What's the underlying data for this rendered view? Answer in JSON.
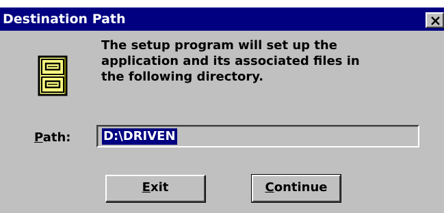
{
  "window": {
    "title": "Destination Path",
    "close_label": "close"
  },
  "message": {
    "lines": [
      "The setup program will set up the",
      "application and its associated files in",
      "the following directory."
    ]
  },
  "path": {
    "label_mnemonic": "P",
    "label_rest": "ath:",
    "value": "D:\\DRIVEN"
  },
  "buttons": {
    "exit": {
      "mnemonic": "E",
      "rest": "xit"
    },
    "continue": {
      "mnemonic": "C",
      "rest": "ontinue"
    }
  },
  "icons": {
    "cabinet": "file-cabinet-icon",
    "close": "close-icon"
  },
  "colors": {
    "titlebar": "#000080",
    "dialog": "#c0c0c0",
    "selection": "#000080",
    "cabinet": "#ffff80"
  }
}
